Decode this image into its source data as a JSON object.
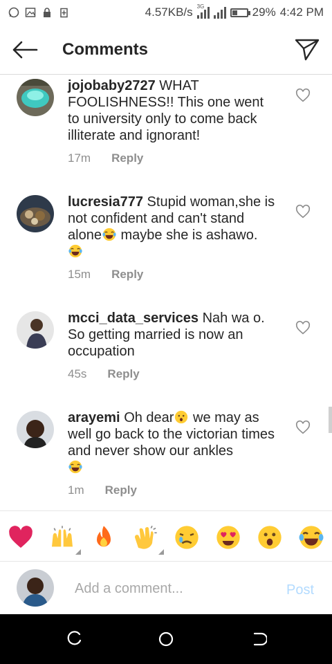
{
  "status_bar": {
    "speed": "4.57KB/s",
    "network": "3G",
    "battery": "29%",
    "time": "4:42 PM"
  },
  "header": {
    "title": "Comments",
    "back_icon": "arrow-left-icon",
    "send_icon": "paper-plane-icon"
  },
  "comments": [
    {
      "username": "jojobaby2727",
      "text": "WHAT FOOLISHNESS!! This one went to university only to come back illiterate and ignorant!",
      "emojis": [],
      "time": "17m",
      "reply_label": "Reply"
    },
    {
      "username": "lucresia777",
      "text_before": "Stupid woman,she is not confident and can't stand alone",
      "text_after": " maybe she is ashawo.",
      "emojis": [
        "tears-of-joy",
        "tears-of-joy"
      ],
      "time": "15m",
      "reply_label": "Reply"
    },
    {
      "username": "mcci_data_services",
      "text": "Nah wa o. So getting married is now an occupation",
      "emojis": [],
      "time": "45s",
      "reply_label": "Reply"
    },
    {
      "username": "arayemi",
      "text_before": "Oh dear",
      "text_after": " we may as well go back to the victorian times and never show our ankles",
      "emojis": [
        "hushed-face",
        "tears-of-joy"
      ],
      "time": "1m",
      "reply_label": "Reply"
    }
  ],
  "emoji_bar": [
    "red-heart",
    "raising-hands",
    "fire",
    "clapping-hands",
    "crying-face",
    "heart-eyes",
    "astonished-face",
    "tears-of-joy"
  ],
  "composer": {
    "placeholder": "Add a comment...",
    "post_label": "Post"
  },
  "colors": {
    "accent_disabled": "#b3dbff",
    "muted_text": "#8e8e8e",
    "heart": "#e0245e"
  }
}
